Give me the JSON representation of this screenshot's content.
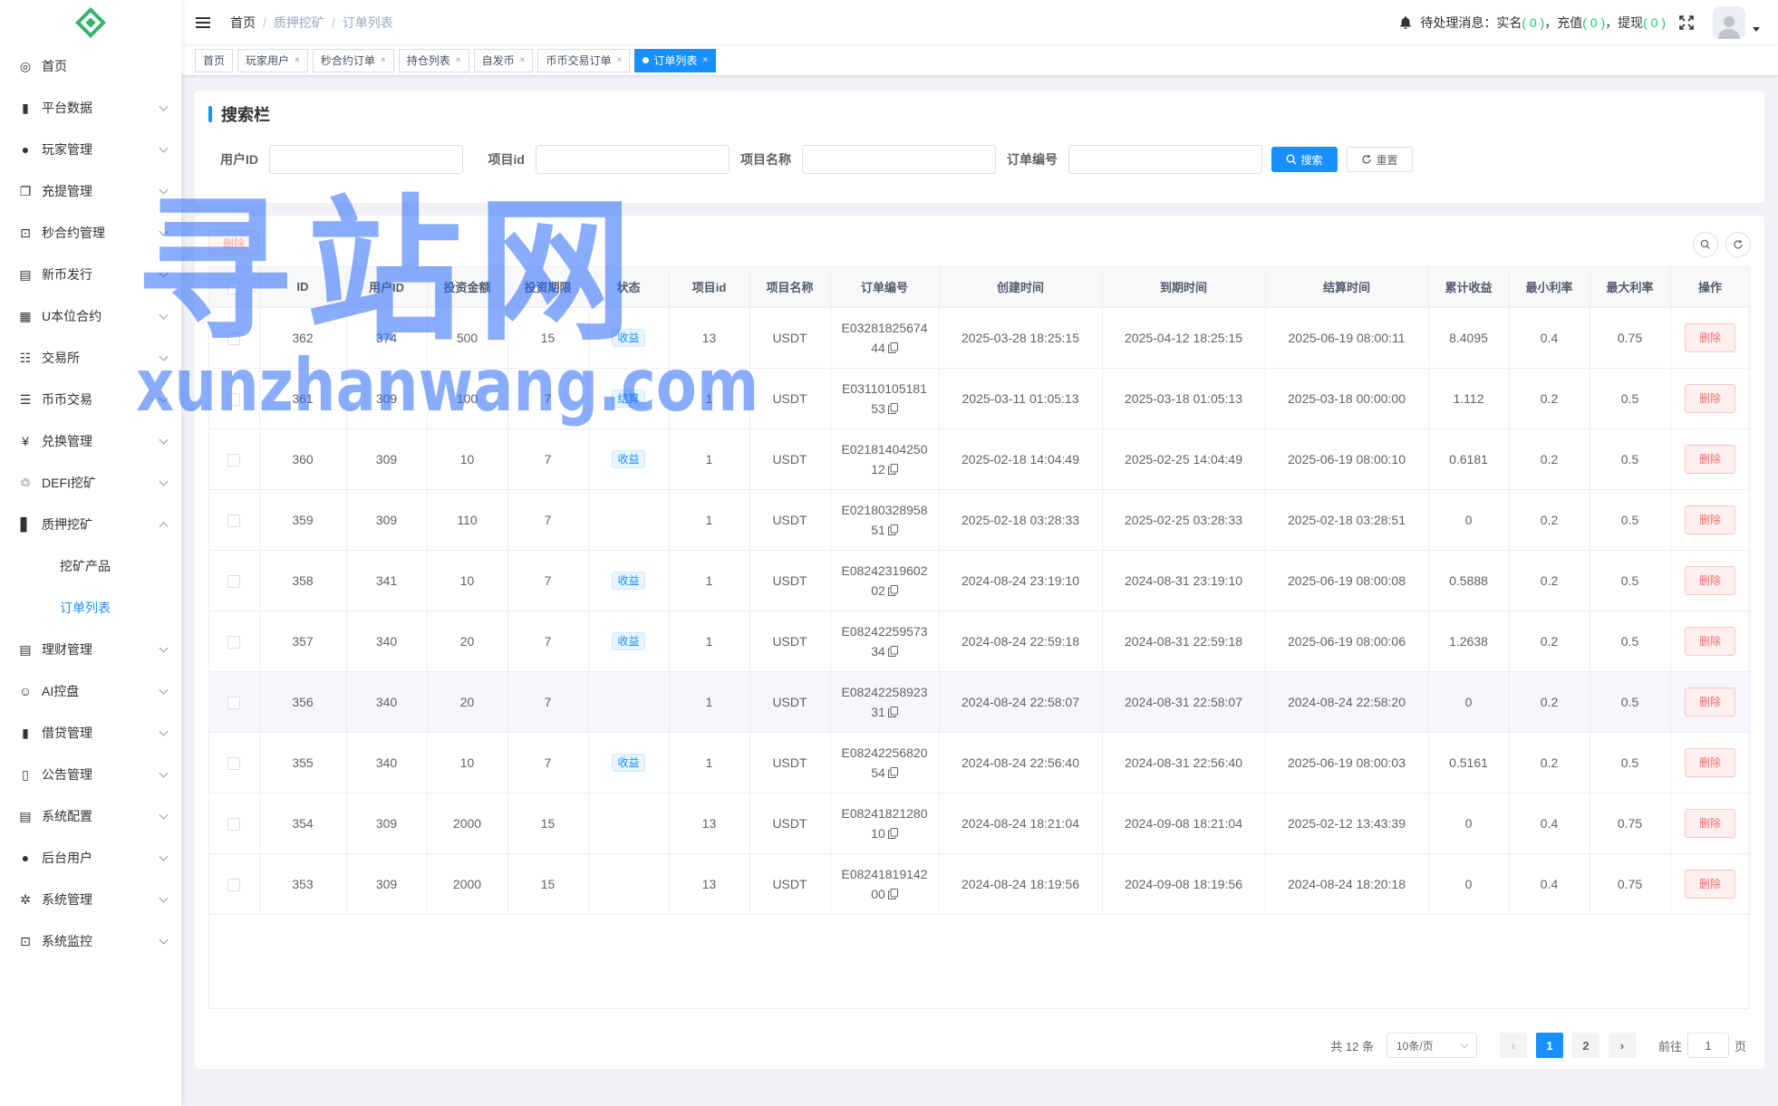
{
  "sidebar": {
    "items": [
      {
        "label": "首页",
        "icon": "dashboard-icon",
        "glyph": "◎",
        "expandable": false
      },
      {
        "label": "平台数据",
        "icon": "book-icon",
        "glyph": "▮",
        "expandable": true
      },
      {
        "label": "玩家管理",
        "icon": "user-icon",
        "glyph": "●",
        "expandable": true
      },
      {
        "label": "充提管理",
        "icon": "copy-icon",
        "glyph": "❐",
        "expandable": true
      },
      {
        "label": "秒合约管理",
        "icon": "chart-icon",
        "glyph": "⊡",
        "expandable": true
      },
      {
        "label": "新币发行",
        "icon": "money-icon",
        "glyph": "▤",
        "expandable": true
      },
      {
        "label": "U本位合约",
        "icon": "table-icon",
        "glyph": "▦",
        "expandable": true
      },
      {
        "label": "交易所",
        "icon": "list-icon",
        "glyph": "☷",
        "expandable": true
      },
      {
        "label": "币币交易",
        "icon": "list-icon",
        "glyph": "☰",
        "expandable": true
      },
      {
        "label": "兑换管理",
        "icon": "yen-icon",
        "glyph": "¥",
        "expandable": true
      },
      {
        "label": "DEFI挖矿",
        "icon": "coins-icon",
        "glyph": "♲",
        "expandable": true
      },
      {
        "label": "质押挖矿",
        "icon": "bar-chart-icon",
        "glyph": "▋",
        "expandable": true,
        "open": true,
        "children": [
          {
            "label": "挖矿产品",
            "active": false
          },
          {
            "label": "订单列表",
            "active": true
          }
        ]
      },
      {
        "label": "理财管理",
        "icon": "document-icon",
        "glyph": "▤",
        "expandable": true
      },
      {
        "label": "AI控盘",
        "icon": "robot-icon",
        "glyph": "☺",
        "expandable": true
      },
      {
        "label": "借贷管理",
        "icon": "book-icon",
        "glyph": "▮",
        "expandable": true
      },
      {
        "label": "公告管理",
        "icon": "read-icon",
        "glyph": "▯",
        "expandable": true
      },
      {
        "label": "系统配置",
        "icon": "document-icon",
        "glyph": "▤",
        "expandable": true
      },
      {
        "label": "后台用户",
        "icon": "peoples-icon",
        "glyph": "●",
        "expandable": true
      },
      {
        "label": "系统管理",
        "icon": "gear-icon",
        "glyph": "✲",
        "expandable": true
      },
      {
        "label": "系统监控",
        "icon": "monitor-icon",
        "glyph": "⊡",
        "expandable": true
      }
    ]
  },
  "navbar": {
    "breadcrumb": [
      "首页",
      "质押挖矿",
      "订单列表"
    ],
    "pending": {
      "label": "待处理消息：",
      "realname": "实名",
      "realname_count": "( 0 )",
      "recharge": "充值",
      "recharge_count": "( 0 )",
      "withdraw": "提现",
      "withdraw_count": "( 0 )",
      "sep": "，"
    }
  },
  "tags": [
    {
      "label": "首页",
      "closable": false,
      "active": false
    },
    {
      "label": "玩家用户",
      "closable": true,
      "active": false
    },
    {
      "label": "秒合约订单",
      "closable": true,
      "active": false
    },
    {
      "label": "持仓列表",
      "closable": true,
      "active": false
    },
    {
      "label": "自发币",
      "closable": true,
      "active": false
    },
    {
      "label": "币币交易订单",
      "closable": true,
      "active": false
    },
    {
      "label": "订单列表",
      "closable": true,
      "active": true
    }
  ],
  "search": {
    "title": "搜索栏",
    "fields": [
      {
        "label": "用户ID",
        "value": "",
        "placeholder": ""
      },
      {
        "label": "项目id",
        "value": "",
        "placeholder": ""
      },
      {
        "label": "项目名称",
        "value": "",
        "placeholder": ""
      },
      {
        "label": "订单编号",
        "value": "",
        "placeholder": ""
      }
    ],
    "search_label": "搜索",
    "reset_label": "重置"
  },
  "toolbar": {
    "delete_label": "删除"
  },
  "table": {
    "columns": [
      "",
      "ID",
      "用户ID",
      "投资金额",
      "投资期限",
      "状态",
      "项目id",
      "项目名称",
      "订单编号",
      "创建时间",
      "到期时间",
      "结算时间",
      "累计收益",
      "最小利率",
      "最大利率",
      "操作"
    ],
    "rows": [
      {
        "id": "362",
        "user_id": "374",
        "amount": "500",
        "days": "15",
        "status": "收益",
        "project_id": "13",
        "project_name": "USDT",
        "order_no_1": "E03281825674",
        "order_no_2": "44",
        "created": "2025-03-28 18:25:15",
        "expire": "2025-04-12 18:25:15",
        "settle": "2025-06-19 08:00:11",
        "income": "8.4095",
        "min_rate": "0.4",
        "max_rate": "0.75"
      },
      {
        "id": "361",
        "user_id": "309",
        "amount": "100",
        "days": "7",
        "status": "结算",
        "project_id": "1",
        "project_name": "USDT",
        "order_no_1": "E03110105181",
        "order_no_2": "53",
        "created": "2025-03-11 01:05:13",
        "expire": "2025-03-18 01:05:13",
        "settle": "2025-03-18 00:00:00",
        "income": "1.112",
        "min_rate": "0.2",
        "max_rate": "0.5"
      },
      {
        "id": "360",
        "user_id": "309",
        "amount": "10",
        "days": "7",
        "status": "收益",
        "project_id": "1",
        "project_name": "USDT",
        "order_no_1": "E02181404250",
        "order_no_2": "12",
        "created": "2025-02-18 14:04:49",
        "expire": "2025-02-25 14:04:49",
        "settle": "2025-06-19 08:00:10",
        "income": "0.6181",
        "min_rate": "0.2",
        "max_rate": "0.5"
      },
      {
        "id": "359",
        "user_id": "309",
        "amount": "110",
        "days": "7",
        "status": "",
        "project_id": "1",
        "project_name": "USDT",
        "order_no_1": "E02180328958",
        "order_no_2": "51",
        "created": "2025-02-18 03:28:33",
        "expire": "2025-02-25 03:28:33",
        "settle": "2025-02-18 03:28:51",
        "income": "0",
        "min_rate": "0.2",
        "max_rate": "0.5"
      },
      {
        "id": "358",
        "user_id": "341",
        "amount": "10",
        "days": "7",
        "status": "收益",
        "project_id": "1",
        "project_name": "USDT",
        "order_no_1": "E08242319602",
        "order_no_2": "02",
        "created": "2024-08-24 23:19:10",
        "expire": "2024-08-31 23:19:10",
        "settle": "2025-06-19 08:00:08",
        "income": "0.5888",
        "min_rate": "0.2",
        "max_rate": "0.5"
      },
      {
        "id": "357",
        "user_id": "340",
        "amount": "20",
        "days": "7",
        "status": "收益",
        "project_id": "1",
        "project_name": "USDT",
        "order_no_1": "E08242259573",
        "order_no_2": "34",
        "created": "2024-08-24 22:59:18",
        "expire": "2024-08-31 22:59:18",
        "settle": "2025-06-19 08:00:06",
        "income": "1.2638",
        "min_rate": "0.2",
        "max_rate": "0.5"
      },
      {
        "id": "356",
        "user_id": "340",
        "amount": "20",
        "days": "7",
        "status": "",
        "project_id": "1",
        "project_name": "USDT",
        "order_no_1": "E08242258923",
        "order_no_2": "31",
        "created": "2024-08-24 22:58:07",
        "expire": "2024-08-31 22:58:07",
        "settle": "2024-08-24 22:58:20",
        "income": "0",
        "min_rate": "0.2",
        "max_rate": "0.5",
        "hover": true
      },
      {
        "id": "355",
        "user_id": "340",
        "amount": "10",
        "days": "7",
        "status": "收益",
        "project_id": "1",
        "project_name": "USDT",
        "order_no_1": "E08242256820",
        "order_no_2": "54",
        "created": "2024-08-24 22:56:40",
        "expire": "2024-08-31 22:56:40",
        "settle": "2025-06-19 08:00:03",
        "income": "0.5161",
        "min_rate": "0.2",
        "max_rate": "0.5"
      },
      {
        "id": "354",
        "user_id": "309",
        "amount": "2000",
        "days": "15",
        "status": "",
        "project_id": "13",
        "project_name": "USDT",
        "order_no_1": "E08241821280",
        "order_no_2": "10",
        "created": "2024-08-24 18:21:04",
        "expire": "2024-09-08 18:21:04",
        "settle": "2025-02-12 13:43:39",
        "income": "0",
        "min_rate": "0.4",
        "max_rate": "0.75"
      },
      {
        "id": "353",
        "user_id": "309",
        "amount": "2000",
        "days": "15",
        "status": "",
        "project_id": "13",
        "project_name": "USDT",
        "order_no_1": "E08241819142",
        "order_no_2": "00",
        "created": "2024-08-24 18:19:56",
        "expire": "2024-09-08 18:19:56",
        "settle": "2024-08-24 18:20:18",
        "income": "0",
        "min_rate": "0.4",
        "max_rate": "0.75"
      }
    ],
    "row_delete_label": "删除"
  },
  "pagination": {
    "total": "共 12 条",
    "page_size": "10条/页",
    "pages": [
      "1",
      "2"
    ],
    "current": "1",
    "goto_prefix": "前往",
    "goto_value": "1",
    "goto_suffix": "页"
  },
  "watermark": {
    "cn": "寻站网",
    "en": "xunzhanwang.com"
  },
  "colors": {
    "primary": "#1890ff",
    "danger": "#f56c6c",
    "success": "#13ce66"
  }
}
